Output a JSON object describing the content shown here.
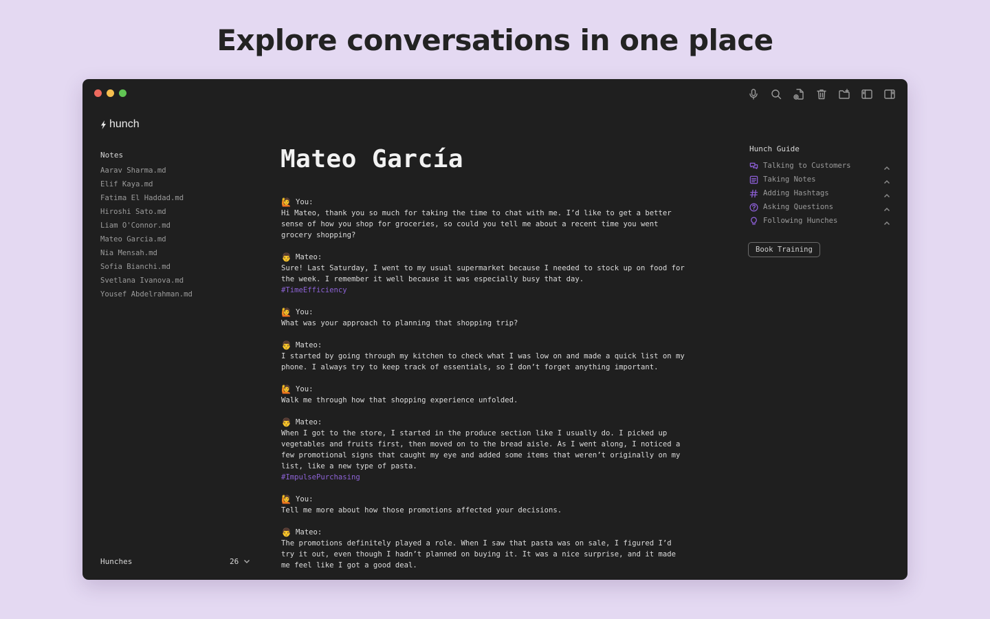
{
  "headline": "Explore conversations in one place",
  "app": {
    "name": "hunch"
  },
  "toolbar": {
    "icons": [
      "microphone-icon",
      "search-icon",
      "new-file-icon",
      "trash-icon",
      "new-folder-icon",
      "left-sidebar-icon",
      "right-sidebar-icon"
    ]
  },
  "sidebar": {
    "title": "Notes",
    "notes": [
      "Aarav Sharma.md",
      "Elif Kaya.md",
      "Fatima El Haddad.md",
      "Hiroshi Sato.md",
      "Liam O'Connor.md",
      "Mateo Garcia.md",
      "Nia Mensah.md",
      "Sofia Bianchi.md",
      "Svetlana Ivanova.md",
      "Yousef Abdelrahman.md"
    ],
    "hunches_label": "Hunches",
    "hunches_count": "26"
  },
  "document": {
    "title": "Mateo García",
    "turns": [
      {
        "emoji": "🙋",
        "speaker": "You:",
        "text": "Hi Mateo, thank you so much for taking the time to chat with me. I’d like to get a better\nsense of how you shop for groceries, so could you tell me about a recent time you went\ngrocery shopping?"
      },
      {
        "emoji": "👨",
        "speaker": "Mateo:",
        "text": "Sure! Last Saturday, I went to my usual supermarket because I needed to stock up on food for\nthe week. I remember it well because it was especially busy that day.",
        "tag": "#TimeEfficiency"
      },
      {
        "emoji": "🙋",
        "speaker": "You:",
        "text": "What was your approach to planning that shopping trip?"
      },
      {
        "emoji": "👨",
        "speaker": "Mateo:",
        "text": "I started by going through my kitchen to check what I was low on and made a quick list on my\nphone. I always try to keep track of essentials, so I don’t forget anything important."
      },
      {
        "emoji": "🙋",
        "speaker": "You:",
        "text": "Walk me through how that shopping experience unfolded."
      },
      {
        "emoji": "👨",
        "speaker": "Mateo:",
        "text": "When I got to the store, I started in the produce section like I usually do. I picked up\nvegetables and fruits first, then moved on to the bread aisle. As I went along, I noticed a\nfew promotional signs that caught my eye and added some items that weren’t originally on my\nlist, like a new type of pasta.",
        "tag": "#ImpulsePurchasing"
      },
      {
        "emoji": "🙋",
        "speaker": "You:",
        "text": "Tell me more about how those promotions affected your decisions."
      },
      {
        "emoji": "👨",
        "speaker": "Mateo:",
        "text": "The promotions definitely played a role. When I saw that pasta was on sale, I figured I’d\ntry it out, even though I hadn’t planned on buying it. It was a nice surprise, and it made\nme feel like I got a good deal."
      }
    ]
  },
  "guide": {
    "title": "Hunch Guide",
    "items": [
      {
        "label": "Talking to Customers",
        "icon": "chat-bubbles-icon"
      },
      {
        "label": "Taking Notes",
        "icon": "notes-icon"
      },
      {
        "label": "Adding Hashtags",
        "icon": "hashtag-icon"
      },
      {
        "label": "Asking Questions",
        "icon": "question-icon"
      },
      {
        "label": "Following Hunches",
        "icon": "lightbulb-icon"
      }
    ],
    "book_button": "Book Training"
  },
  "colors": {
    "background": "#e4d9f2",
    "window": "#1f1f1f",
    "accent": "#8d63d6"
  }
}
